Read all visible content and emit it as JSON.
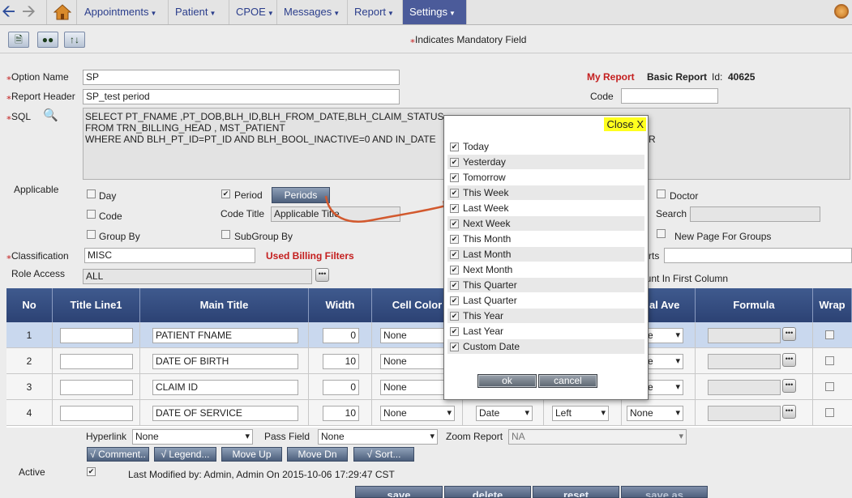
{
  "nav": {
    "items": [
      "Appointments",
      "Patient",
      "CPOE",
      "Messages",
      "Report",
      "Settings"
    ],
    "active": "Settings"
  },
  "toolbar": {
    "mandatory_note": "Indicates Mandatory Field"
  },
  "form": {
    "option_name_label": "Option Name",
    "option_name_value": "SP",
    "report_header_label": "Report Header",
    "report_header_value": "SP_test period",
    "sql_label": "SQL",
    "sql_lines": [
      "SELECT PT_FNAME ,PT_DOB,BLH_ID,BLH_FROM_DATE,BLH_CLAIM_STATUS",
      "FROM TRN_BILLING_HEAD , MST_PATIENT",
      "WHERE AND BLH_PT_ID=PT_ID AND BLH_BOOL_INACTIVE=0 AND IN_DATE"
    ],
    "sql_tail": "R",
    "my_report": "My Report",
    "basic_report": "Basic Report",
    "id_label": "Id:",
    "id_value": "40625",
    "code_label": "Code",
    "code_value": "",
    "applicable_label": "Applicable",
    "day_label": "Day",
    "period_label": "Period",
    "periods_button": "Periods",
    "doctor_label": "Doctor",
    "code_chk_label": "Code",
    "code_title_label": "Code Title",
    "code_title_value": "Applicable Title",
    "search_label": "Search",
    "group_by_label": "Group By",
    "subgroup_by_label": "SubGroup By",
    "new_page_label": "New Page For Groups",
    "classification_label": "Classification",
    "classification_value": "MISC",
    "used_billing_filters": "Used Billing Filters",
    "rts_label": "rts",
    "role_access_label": "Role Access",
    "role_access_value": "ALL",
    "count_first_col": "ount In First Column"
  },
  "grid": {
    "headers": [
      "No",
      "Title Line1",
      "Main Title",
      "Width",
      "Cell Color",
      "",
      "",
      "al Ave",
      "Formula",
      "Wrap"
    ],
    "rows": [
      {
        "no": "1",
        "title1": "",
        "main": "PATIENT FNAME",
        "width": "0",
        "cell_color": "None",
        "ave": "None"
      },
      {
        "no": "2",
        "title1": "",
        "main": "DATE OF BIRTH",
        "width": "10",
        "cell_color": "None",
        "ave": "None"
      },
      {
        "no": "3",
        "title1": "",
        "main": "CLAIM ID",
        "width": "0",
        "cell_color": "None",
        "ave": "None"
      },
      {
        "no": "4",
        "title1": "",
        "main": "DATE OF SERVICE",
        "width": "10",
        "cell_color": "None",
        "format": "Date",
        "align": "Left",
        "ave": "None"
      }
    ]
  },
  "footer": {
    "hyperlink_label": "Hyperlink",
    "hyperlink_value": "None",
    "pass_field_label": "Pass Field",
    "pass_field_value": "None",
    "zoom_report_label": "Zoom Report",
    "zoom_report_value": "NA",
    "buttons": [
      "√ Comment..",
      "√ Legend...",
      "Move Up",
      "Move Dn",
      "√ Sort..."
    ],
    "active_label": "Active",
    "last_modified": "Last Modified by: Admin, Admin On 2015-10-06 17:29:47 CST",
    "bottom_buttons": [
      "save",
      "delete",
      "reset",
      "save as"
    ]
  },
  "popup": {
    "close_label": "Close X",
    "items": [
      "Today",
      "Yesterday",
      "Tomorrow",
      "This Week",
      "Last Week",
      "Next Week",
      "This Month",
      "Last Month",
      "Next Month",
      "This Quarter",
      "Last Quarter",
      "This Year",
      "Last Year",
      "Custom Date"
    ],
    "ok_label": "ok",
    "cancel_label": "cancel"
  },
  "colors": {
    "nav_active_bg": "#4b5b9a",
    "grid_header_bg": "#2c4274",
    "mandatory_red": "#c41e1e",
    "close_bg": "#ffff1e"
  }
}
